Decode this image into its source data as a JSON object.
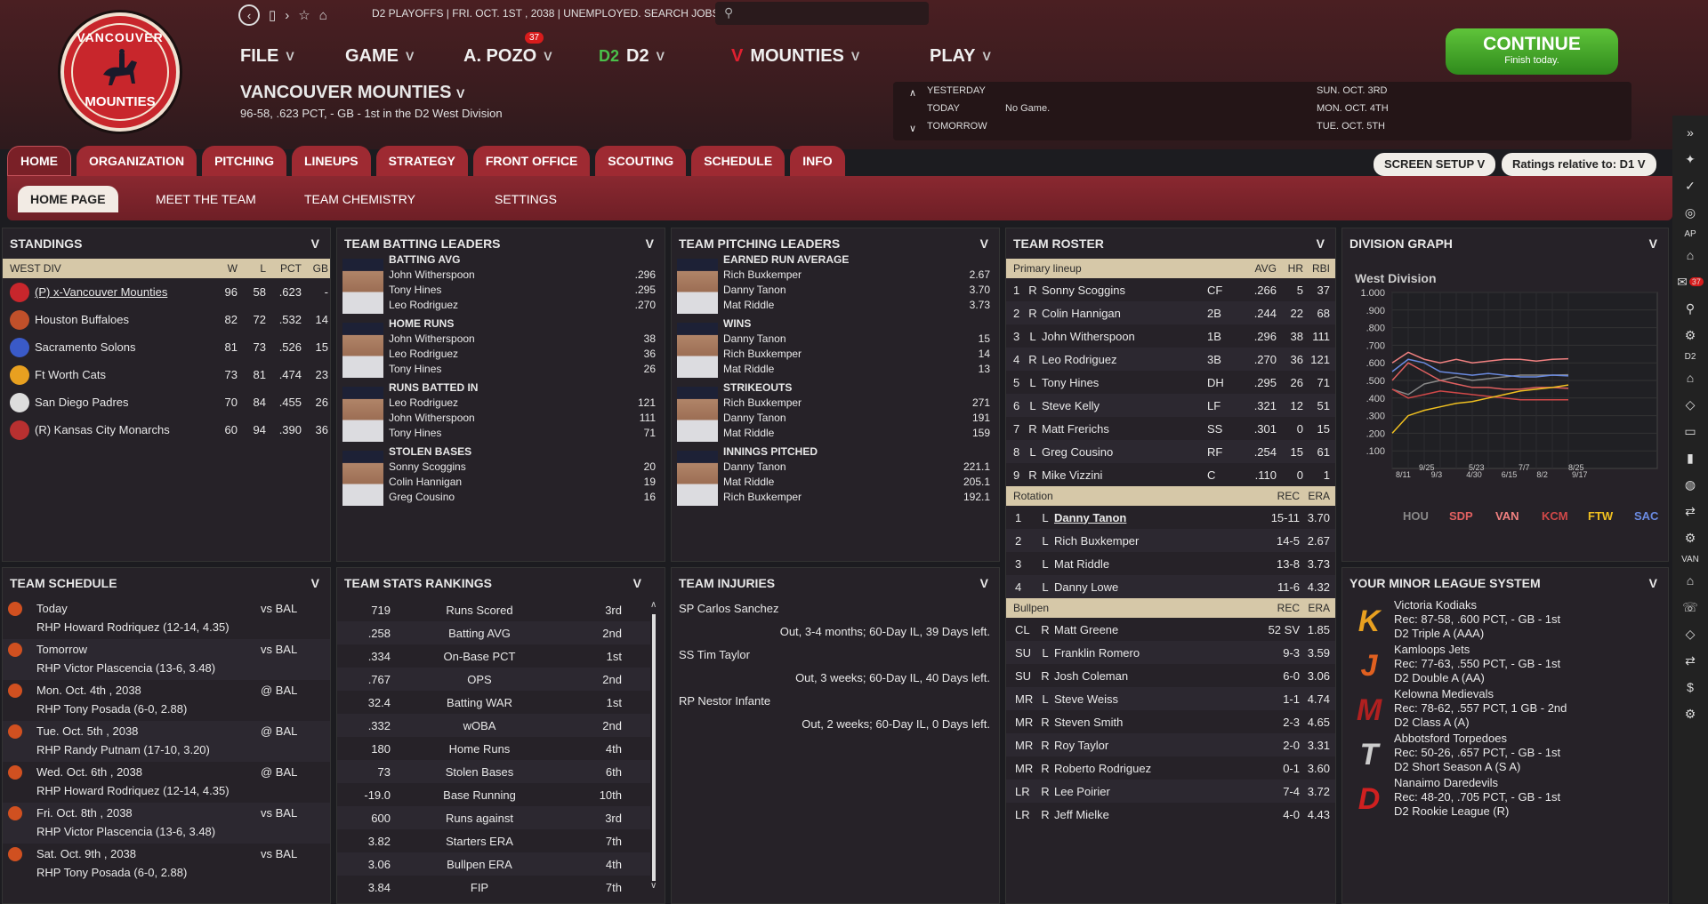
{
  "top": {
    "crumbs": "D2 PLAYOFFS  |  FRI. OCT. 1ST , 2038  |  UNEMPLOYED. SEARCH JOBS...",
    "logo_top": "VANCOUVER",
    "logo_bottom": "MOUNTIES",
    "nav": {
      "file": "FILE",
      "game": "GAME",
      "manager": "A. POZO",
      "manager_badge": "37",
      "league": "D2",
      "team": "MOUNTIES",
      "play": "PLAY"
    },
    "team_name": "VANCOUVER MOUNTIES",
    "team_record": "96-58, .623 PCT, - GB - 1st in the D2 West Division",
    "dates": {
      "yesterday": "YESTERDAY",
      "today": "TODAY",
      "tomorrow": "TOMORROW",
      "today_text": "No Game.",
      "d1": "SUN. OCT. 3RD",
      "d2": "MON. OCT. 4TH",
      "d3": "TUE. OCT. 5TH"
    },
    "continue_label": "CONTINUE",
    "continue_sub": "Finish today."
  },
  "tabs": [
    "HOME",
    "ORGANIZATION",
    "PITCHING",
    "LINEUPS",
    "STRATEGY",
    "FRONT OFFICE",
    "SCOUTING",
    "SCHEDULE",
    "INFO"
  ],
  "subtabs": [
    "HOME PAGE",
    "MEET THE TEAM",
    "TEAM CHEMISTRY",
    "SETTINGS"
  ],
  "screen_setup": "SCREEN SETUP",
  "ratings": "Ratings relative to: D1",
  "sidebar_labels": {
    "ap": "AP",
    "d2": "D2",
    "van": "VAN",
    "mail_badge": "37"
  },
  "standings": {
    "title": "STANDINGS",
    "header": {
      "div": "WEST DIV",
      "w": "W",
      "l": "L",
      "pct": "PCT",
      "gb": "GB"
    },
    "rows": [
      {
        "team": "(P) x-Vancouver Mounties",
        "w": "96",
        "l": "58",
        "pct": ".623",
        "gb": "-",
        "color": "#c8262c"
      },
      {
        "team": "Houston Buffaloes",
        "w": "82",
        "l": "72",
        "pct": ".532",
        "gb": "14",
        "color": "#c0502a"
      },
      {
        "team": "Sacramento Solons",
        "w": "81",
        "l": "73",
        "pct": ".526",
        "gb": "15",
        "color": "#3a5ac8"
      },
      {
        "team": "Ft Worth Cats",
        "w": "73",
        "l": "81",
        "pct": ".474",
        "gb": "23",
        "color": "#e8a020"
      },
      {
        "team": "San Diego Padres",
        "w": "70",
        "l": "84",
        "pct": ".455",
        "gb": "26",
        "color": "#dddddd"
      },
      {
        "team": "(R) Kansas City Monarchs",
        "w": "60",
        "l": "94",
        "pct": ".390",
        "gb": "36",
        "color": "#b83030"
      }
    ]
  },
  "batting_leaders": {
    "title": "TEAM BATTING LEADERS",
    "cats": [
      {
        "cat": "BATTING AVG",
        "rows": [
          [
            "John Witherspoon",
            ".296"
          ],
          [
            "Tony Hines",
            ".295"
          ],
          [
            "Leo Rodriguez",
            ".270"
          ]
        ]
      },
      {
        "cat": "HOME RUNS",
        "rows": [
          [
            "John Witherspoon",
            "38"
          ],
          [
            "Leo Rodriguez",
            "36"
          ],
          [
            "Tony Hines",
            "26"
          ]
        ]
      },
      {
        "cat": "RUNS BATTED IN",
        "rows": [
          [
            "Leo Rodriguez",
            "121"
          ],
          [
            "John Witherspoon",
            "111"
          ],
          [
            "Tony Hines",
            "71"
          ]
        ]
      },
      {
        "cat": "STOLEN BASES",
        "rows": [
          [
            "Sonny Scoggins",
            "20"
          ],
          [
            "Colin Hannigan",
            "19"
          ],
          [
            "Greg Cousino",
            "16"
          ]
        ]
      }
    ]
  },
  "pitching_leaders": {
    "title": "TEAM PITCHING LEADERS",
    "cats": [
      {
        "cat": "EARNED RUN AVERAGE",
        "rows": [
          [
            "Rich Buxkemper",
            "2.67"
          ],
          [
            "Danny Tanon",
            "3.70"
          ],
          [
            "Mat Riddle",
            "3.73"
          ]
        ]
      },
      {
        "cat": "WINS",
        "rows": [
          [
            "Danny Tanon",
            "15"
          ],
          [
            "Rich Buxkemper",
            "14"
          ],
          [
            "Mat Riddle",
            "13"
          ]
        ]
      },
      {
        "cat": "STRIKEOUTS",
        "rows": [
          [
            "Rich Buxkemper",
            "271"
          ],
          [
            "Danny Tanon",
            "191"
          ],
          [
            "Mat Riddle",
            "159"
          ]
        ]
      },
      {
        "cat": "INNINGS PITCHED",
        "rows": [
          [
            "Danny Tanon",
            "221.1"
          ],
          [
            "Mat Riddle",
            "205.1"
          ],
          [
            "Rich Buxkemper",
            "192.1"
          ]
        ]
      }
    ]
  },
  "roster": {
    "title": "TEAM ROSTER",
    "lineup_header": {
      "name": "Primary lineup",
      "avg": "AVG",
      "hr": "HR",
      "rbi": "RBI"
    },
    "lineup": [
      [
        "1",
        "R",
        "Sonny Scoggins",
        "CF",
        ".266",
        "5",
        "37"
      ],
      [
        "2",
        "R",
        "Colin Hannigan",
        "2B",
        ".244",
        "22",
        "68"
      ],
      [
        "3",
        "L",
        "John Witherspoon",
        "1B",
        ".296",
        "38",
        "111"
      ],
      [
        "4",
        "R",
        "Leo Rodriguez",
        "3B",
        ".270",
        "36",
        "121"
      ],
      [
        "5",
        "L",
        "Tony Hines",
        "DH",
        ".295",
        "26",
        "71"
      ],
      [
        "6",
        "L",
        "Steve Kelly",
        "LF",
        ".321",
        "12",
        "51"
      ],
      [
        "7",
        "R",
        "Matt Frerichs",
        "SS",
        ".301",
        "0",
        "15"
      ],
      [
        "8",
        "L",
        "Greg Cousino",
        "RF",
        ".254",
        "15",
        "61"
      ],
      [
        "9",
        "R",
        "Mike Vizzini",
        "C",
        ".110",
        "0",
        "1"
      ]
    ],
    "rotation_header": {
      "name": "Rotation",
      "rec": "REC",
      "era": "ERA"
    },
    "rotation": [
      [
        "1",
        "L",
        "Danny Tanon",
        "15-11",
        "3.70"
      ],
      [
        "2",
        "L",
        "Rich Buxkemper",
        "14-5",
        "2.67"
      ],
      [
        "3",
        "L",
        "Mat Riddle",
        "13-8",
        "3.73"
      ],
      [
        "4",
        "L",
        "Danny Lowe",
        "11-6",
        "4.32"
      ]
    ],
    "bullpen_header": {
      "name": "Bullpen",
      "rec": "REC",
      "era": "ERA"
    },
    "bullpen": [
      [
        "CL",
        "R",
        "Matt Greene",
        "52 SV",
        "1.85"
      ],
      [
        "SU",
        "L",
        "Franklin Romero",
        "9-3",
        "3.59"
      ],
      [
        "SU",
        "R",
        "Josh Coleman",
        "6-0",
        "3.06"
      ],
      [
        "MR",
        "L",
        "Steve Weiss",
        "1-1",
        "4.74"
      ],
      [
        "MR",
        "R",
        "Steven Smith",
        "2-3",
        "4.65"
      ],
      [
        "MR",
        "R",
        "Roy Taylor",
        "2-0",
        "3.31"
      ],
      [
        "MR",
        "R",
        "Roberto Rodriguez",
        "0-1",
        "3.60"
      ],
      [
        "LR",
        "R",
        "Lee Poirier",
        "7-4",
        "3.72"
      ],
      [
        "LR",
        "R",
        "Jeff Mielke",
        "4-0",
        "4.43"
      ]
    ]
  },
  "division_graph": {
    "title": "DIVISION GRAPH",
    "subtitle": "West Division"
  },
  "chart_data": {
    "type": "line",
    "title": "West Division",
    "ylim": [
      0,
      1
    ],
    "yticks": [
      "1.000",
      ".900",
      ".800",
      ".700",
      ".600",
      ".500",
      ".400",
      ".300",
      ".200",
      ".100"
    ],
    "xticks_top": [
      "8/11",
      "9/3",
      "4/30",
      "6/15",
      "8/2",
      "9/17"
    ],
    "xticks_mid": [
      "9/25",
      "5/23",
      "7/7",
      "8/25"
    ],
    "x": [
      "4/1",
      "4/15",
      "4/30",
      "5/15",
      "6/1",
      "6/15",
      "7/1",
      "7/15",
      "8/1",
      "8/15",
      "9/1",
      "9/17"
    ],
    "series": [
      {
        "name": "HOU",
        "color": "#888888",
        "values": [
          0.45,
          0.42,
          0.48,
          0.5,
          0.52,
          0.5,
          0.51,
          0.52,
          0.53,
          0.53,
          0.53,
          0.532
        ]
      },
      {
        "name": "SDP",
        "color": "#e06060",
        "values": [
          0.5,
          0.6,
          0.55,
          0.5,
          0.48,
          0.46,
          0.46,
          0.45,
          0.45,
          0.46,
          0.46,
          0.455
        ]
      },
      {
        "name": "VAN",
        "color": "#f08080",
        "values": [
          0.6,
          0.66,
          0.62,
          0.6,
          0.62,
          0.6,
          0.61,
          0.62,
          0.62,
          0.61,
          0.62,
          0.623
        ]
      },
      {
        "name": "KCM",
        "color": "#d04848",
        "values": [
          0.45,
          0.4,
          0.42,
          0.44,
          0.43,
          0.42,
          0.41,
          0.4,
          0.39,
          0.39,
          0.39,
          0.39
        ]
      },
      {
        "name": "FTW",
        "color": "#f0c020",
        "values": [
          0.2,
          0.3,
          0.33,
          0.35,
          0.37,
          0.38,
          0.4,
          0.42,
          0.44,
          0.45,
          0.46,
          0.474
        ]
      },
      {
        "name": "SAC",
        "color": "#6a8ae0",
        "values": [
          0.55,
          0.62,
          0.6,
          0.55,
          0.54,
          0.53,
          0.54,
          0.53,
          0.52,
          0.52,
          0.53,
          0.526
        ]
      }
    ]
  },
  "schedule": {
    "title": "TEAM SCHEDULE",
    "rows": [
      {
        "day": "Today",
        "opp": "vs BAL",
        "sp": "RHP Howard Rodriquez (12-14, 4.35)"
      },
      {
        "day": "Tomorrow",
        "opp": "vs BAL",
        "sp": "RHP Victor Plascencia (13-6, 3.48)"
      },
      {
        "day": "Mon. Oct. 4th , 2038",
        "opp": "@ BAL",
        "sp": "RHP Tony Posada (6-0, 2.88)"
      },
      {
        "day": "Tue. Oct. 5th , 2038",
        "opp": "@ BAL",
        "sp": "RHP Randy Putnam (17-10, 3.20)"
      },
      {
        "day": "Wed. Oct. 6th , 2038",
        "opp": "@ BAL",
        "sp": "RHP Howard Rodriquez (12-14, 4.35)"
      },
      {
        "day": "Fri. Oct. 8th , 2038",
        "opp": "vs BAL",
        "sp": "RHP Victor Plascencia (13-6, 3.48)"
      },
      {
        "day": "Sat. Oct. 9th , 2038",
        "opp": "vs BAL",
        "sp": "RHP Tony Posada (6-0, 2.88)"
      }
    ]
  },
  "stats_rankings": {
    "title": "TEAM STATS RANKINGS",
    "rows": [
      [
        "719",
        "Runs Scored",
        "3rd"
      ],
      [
        ".258",
        "Batting AVG",
        "2nd"
      ],
      [
        ".334",
        "On-Base PCT",
        "1st"
      ],
      [
        ".767",
        "OPS",
        "2nd"
      ],
      [
        "32.4",
        "Batting WAR",
        "1st"
      ],
      [
        ".332",
        "wOBA",
        "2nd"
      ],
      [
        "180",
        "Home Runs",
        "4th"
      ],
      [
        "73",
        "Stolen Bases",
        "6th"
      ],
      [
        "-19.0",
        "Base Running",
        "10th"
      ],
      [
        "600",
        "Runs against",
        "3rd"
      ],
      [
        "3.82",
        "Starters ERA",
        "7th"
      ],
      [
        "3.06",
        "Bullpen ERA",
        "4th"
      ],
      [
        "3.84",
        "FIP",
        "7th"
      ]
    ]
  },
  "injuries": {
    "title": "TEAM INJURIES",
    "rows": [
      {
        "name": "SP Carlos Sanchez",
        "detail": "Out, 3-4 months; 60-Day IL, 39 Days left."
      },
      {
        "name": "SS Tim Taylor",
        "detail": "Out, 3 weeks; 60-Day IL, 40 Days left."
      },
      {
        "name": "RP Nestor Infante",
        "detail": "Out, 2 weeks; 60-Day IL, 0 Days left."
      }
    ]
  },
  "minors": {
    "title": "YOUR MINOR LEAGUE SYSTEM",
    "rows": [
      {
        "team": "Victoria Kodiaks",
        "rec": "Rec: 87-58, .600 PCT, - GB - 1st",
        "lvl": "D2 Triple A (AAA)",
        "color": "#e8a020",
        "letter": "K"
      },
      {
        "team": "Kamloops Jets",
        "rec": "Rec: 77-63, .550 PCT, - GB - 1st",
        "lvl": "D2 Double A (AA)",
        "color": "#e06020",
        "letter": "J"
      },
      {
        "team": "Kelowna Medievals",
        "rec": "Rec: 78-62, .557 PCT, 1 GB - 2nd",
        "lvl": "D2 Class A (A)",
        "color": "#b02020",
        "letter": "M"
      },
      {
        "team": "Abbotsford Torpedoes",
        "rec": "Rec: 50-26, .657 PCT, - GB - 1st",
        "lvl": "D2 Short Season A (S A)",
        "color": "#cccccc",
        "letter": "T"
      },
      {
        "team": "Nanaimo Daredevils",
        "rec": "Rec: 48-20, .705 PCT, - GB - 1st",
        "lvl": "D2 Rookie League (R)",
        "color": "#d02020",
        "letter": "D"
      }
    ]
  }
}
